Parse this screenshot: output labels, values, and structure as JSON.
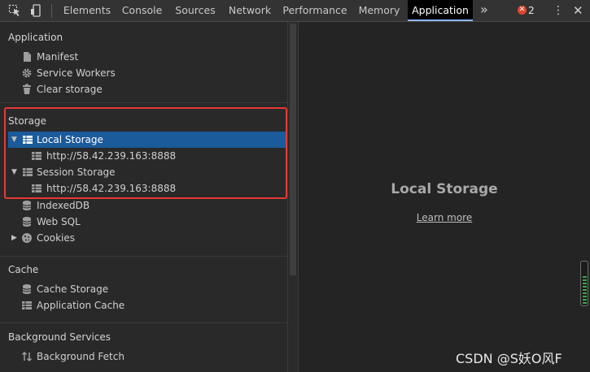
{
  "toolbar": {
    "tabs": [
      {
        "label": "Elements"
      },
      {
        "label": "Console"
      },
      {
        "label": "Sources"
      },
      {
        "label": "Network"
      },
      {
        "label": "Performance"
      },
      {
        "label": "Memory"
      },
      {
        "label": "Application",
        "active": true
      }
    ],
    "more_label": "»",
    "error_count": "2",
    "kebab": "⋮",
    "close": "✕"
  },
  "sidebar": {
    "application": {
      "title": "Application",
      "items": [
        {
          "label": "Manifest",
          "icon": "document-icon"
        },
        {
          "label": "Service Workers",
          "icon": "gear-icon"
        },
        {
          "label": "Clear storage",
          "icon": "trash-icon"
        }
      ]
    },
    "storage": {
      "title": "Storage",
      "local_storage": {
        "label": "Local Storage",
        "child": "http://58.42.239.163:8888"
      },
      "session_storage": {
        "label": "Session Storage",
        "child": "http://58.42.239.163:8888"
      },
      "items": [
        {
          "label": "IndexedDB",
          "icon": "database-icon"
        },
        {
          "label": "Web SQL",
          "icon": "database-icon"
        },
        {
          "label": "Cookies",
          "icon": "cookie-icon"
        }
      ]
    },
    "cache": {
      "title": "Cache",
      "items": [
        {
          "label": "Cache Storage",
          "icon": "database-icon"
        },
        {
          "label": "Application Cache",
          "icon": "grid-icon"
        }
      ]
    },
    "background": {
      "title": "Background Services",
      "items": [
        {
          "label": "Background Fetch",
          "icon": "up-down-arrows-icon"
        }
      ]
    }
  },
  "main": {
    "title": "Local Storage",
    "link": "Learn more"
  },
  "watermark": "CSDN @S妖O风F",
  "colors": {
    "selection": "#1b5a9b",
    "highlight_box": "#e53935",
    "active_tab_underline": "#8ab4f8",
    "error": "#e0462f"
  }
}
